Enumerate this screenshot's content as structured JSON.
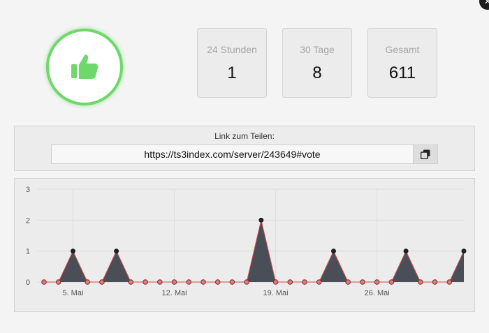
{
  "close_label": "✕",
  "stats": [
    {
      "label": "24 Stunden",
      "value": "1"
    },
    {
      "label": "30 Tage",
      "value": "8"
    },
    {
      "label": "Gesamt",
      "value": "611"
    }
  ],
  "share": {
    "label": "Link zum Teilen:",
    "url": "https://ts3index.com/server/243649#vote"
  },
  "icons": {
    "thumb": "thumbs-up-icon",
    "copy": "copy-icon",
    "close": "close-icon"
  },
  "colors": {
    "accent_green": "#6fd86a",
    "area_fill": "#4a4e57",
    "zero_point": "#e07a7a"
  },
  "chart_data": {
    "type": "area",
    "x_tick_labels": [
      "5. Mai",
      "12. Mai",
      "19. Mai",
      "26. Mai"
    ],
    "x_tick_positions": [
      2,
      9,
      16,
      23
    ],
    "y_ticks": [
      0,
      1,
      2,
      3
    ],
    "ylim": [
      0,
      3
    ],
    "grid": true,
    "values": [
      0,
      0,
      1,
      0,
      0,
      1,
      0,
      0,
      0,
      0,
      0,
      0,
      0,
      0,
      0,
      2,
      0,
      0,
      0,
      0,
      1,
      0,
      0,
      0,
      0,
      1,
      0,
      0,
      0,
      1
    ]
  }
}
